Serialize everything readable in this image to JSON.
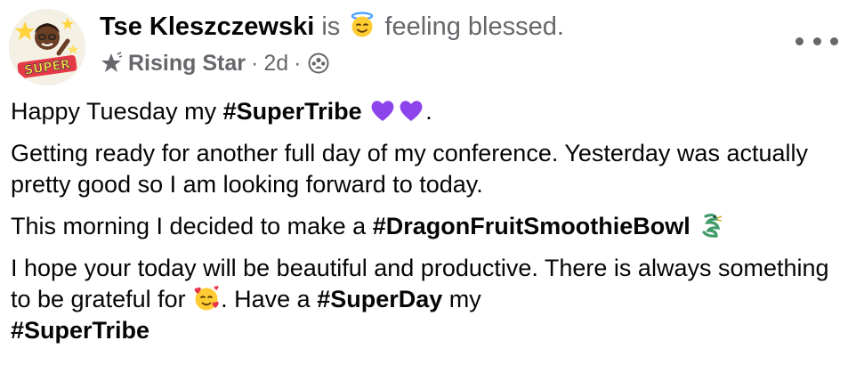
{
  "post": {
    "author_name": "Tse Kleszczewski",
    "activity_is": "is",
    "activity_feeling": "feeling blessed.",
    "badge_label": "Rising Star",
    "meta_separator": "·",
    "timestamp": "2d",
    "more_icon": "more-horizontal-icon",
    "avatar_text": "SUPER",
    "paragraphs": {
      "p1": {
        "text_a": "Happy Tuesday my ",
        "hashtag": "#SuperTribe",
        "trail": "."
      },
      "p2": {
        "text": "Getting ready for another full day of my conference.  Yesterday was actually pretty good so I am looking forward to today."
      },
      "p3": {
        "text_a": "This morning I decided to make a ",
        "hashtag": "#DragonFruitSmoothieBowl"
      },
      "p4": {
        "text_a": "I hope your today will be beautiful and productive.  There is always something to be grateful for ",
        "text_b": ".  Have a ",
        "hashtag1": "#SuperDay",
        "text_c": " my ",
        "hashtag2": "#SuperTribe"
      }
    }
  },
  "colors": {
    "secondary_text": "#65676b",
    "primary_text": "#050505",
    "heart_purple": "#8e44ec"
  }
}
